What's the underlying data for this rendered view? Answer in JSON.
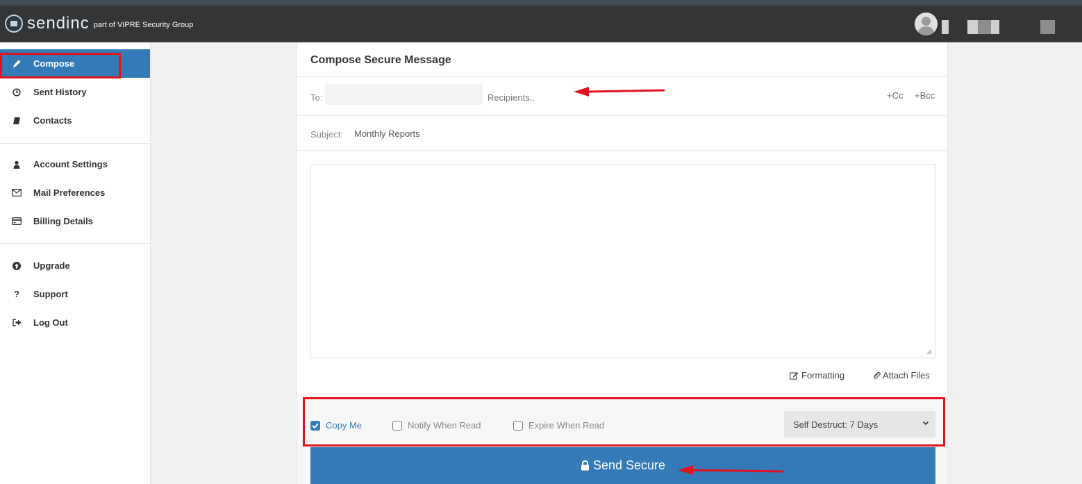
{
  "header": {
    "brand_name": "sendinc",
    "brand_subtitle": "part of VIPRE Security Group"
  },
  "sidebar": {
    "items": [
      {
        "label": "Compose",
        "icon": "pencil-icon",
        "active": true
      },
      {
        "label": "Sent History",
        "icon": "clock-icon"
      },
      {
        "label": "Contacts",
        "icon": "book-icon"
      },
      {
        "label": "Account Settings",
        "icon": "user-icon"
      },
      {
        "label": "Mail Preferences",
        "icon": "envelope-icon"
      },
      {
        "label": "Billing Details",
        "icon": "credit-card-icon"
      },
      {
        "label": "Upgrade",
        "icon": "arrow-up-circle-icon"
      },
      {
        "label": "Support",
        "icon": "question-icon"
      },
      {
        "label": "Log Out",
        "icon": "sign-out-icon"
      }
    ]
  },
  "compose": {
    "title": "Compose Secure Message",
    "to_label": "To:",
    "recipients_placeholder": "Recipients..",
    "cc_label": "+Cc",
    "bcc_label": "+Bcc",
    "subject_label": "Subject:",
    "subject_value": "Monthly Reports",
    "body_value": "",
    "formatting_label": "Formatting",
    "attach_label": "Attach Files"
  },
  "options": {
    "copy_me": {
      "label": "Copy Me",
      "checked": true
    },
    "notify_when_read": {
      "label": "Notify When Read",
      "checked": false
    },
    "expire_when_read": {
      "label": "Expire When Read",
      "checked": false
    },
    "self_destruct": "Self Destruct: 7 Days"
  },
  "send_label": "Send Secure",
  "colors": {
    "topbar": "#333537",
    "accent": "#337ab7",
    "highlight": "#e0141e"
  }
}
